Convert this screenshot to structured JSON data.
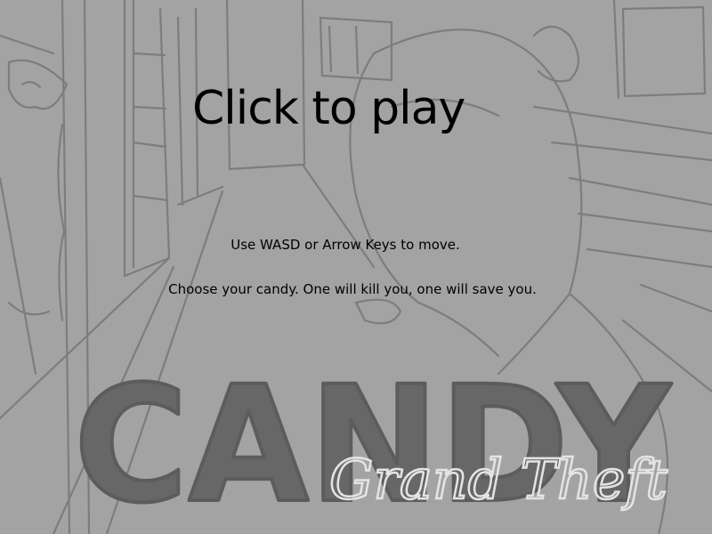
{
  "game": {
    "title_main": "CANDY",
    "title_sub": "Grand Theft",
    "play_prompt": "Click to play",
    "instructions": [
      "Use WASD or Arrow Keys to move.",
      "Choose your candy. One will kill you, one will save you."
    ]
  },
  "colors": {
    "background": "#a3a3a3",
    "sketch_lines": "#7a7a7a",
    "logo_fill": "#666666",
    "logo_sub": "#e2e2e2",
    "text": "#000000"
  }
}
